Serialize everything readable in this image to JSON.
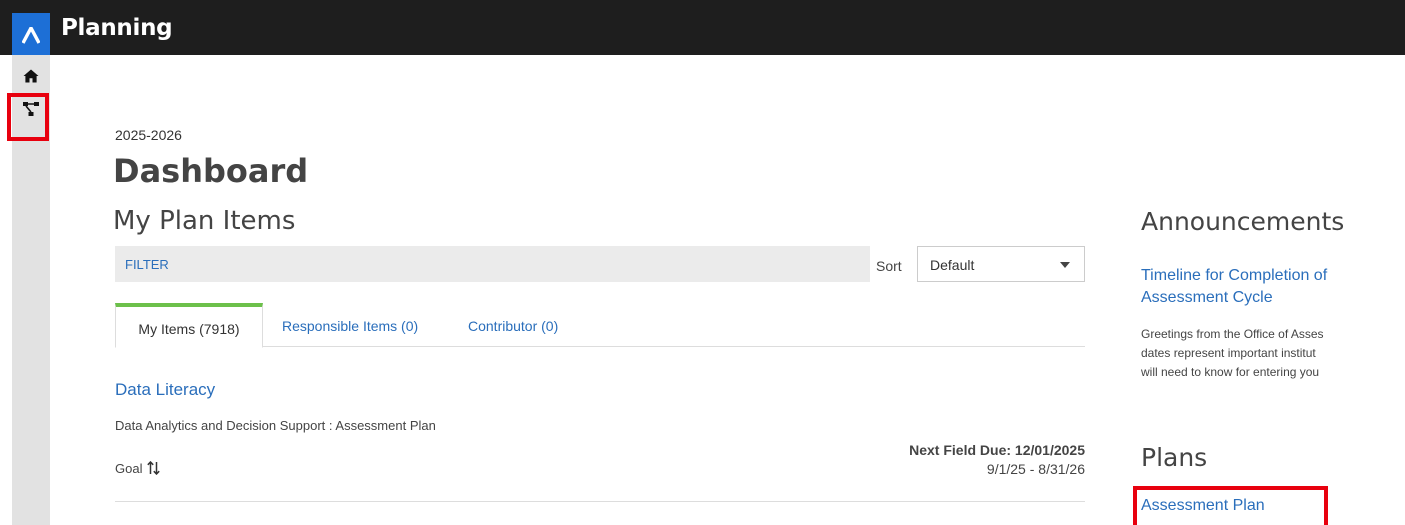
{
  "header": {
    "app_title": "Planning",
    "logo_icon": "anthology-logo-icon"
  },
  "rail": {
    "home_icon": "home-icon",
    "hierarchy_icon": "hierarchy-icon"
  },
  "main": {
    "year": "2025-2026",
    "page_title": "Dashboard",
    "section_title": "My Plan Items",
    "filter_label": "FILTER",
    "sort_label": "Sort",
    "sort_value": "Default",
    "tabs": [
      {
        "label": "My Items (7918)",
        "active": true
      },
      {
        "label": "Responsible Items (0)",
        "active": false
      },
      {
        "label": "Contributor (0)",
        "active": false
      }
    ],
    "items": [
      {
        "title": "Data Literacy",
        "subtitle": "Data Analytics and Decision Support : Assessment Plan",
        "type": "Goal",
        "next_due": "Next Field Due: 12/01/2025",
        "date_range": "9/1/25 - 8/31/26"
      }
    ]
  },
  "sidebar_right": {
    "announcements_title": "Announcements",
    "announcement_link_line1": "Timeline for Completion of",
    "announcement_link_line2": "Assessment Cycle",
    "announcement_text_line1": "Greetings from the Office of Asses",
    "announcement_text_line2": "dates represent important institut",
    "announcement_text_line3": "will need to know for entering you",
    "plans_title": "Plans",
    "plans_link": "Assessment Plan"
  },
  "colors": {
    "accent_link": "#2a6ebb",
    "active_tab": "#6cc04a",
    "highlight": "#e8000e",
    "header_bg": "#1e1e1e",
    "logo_bg": "#1d6fd6"
  }
}
